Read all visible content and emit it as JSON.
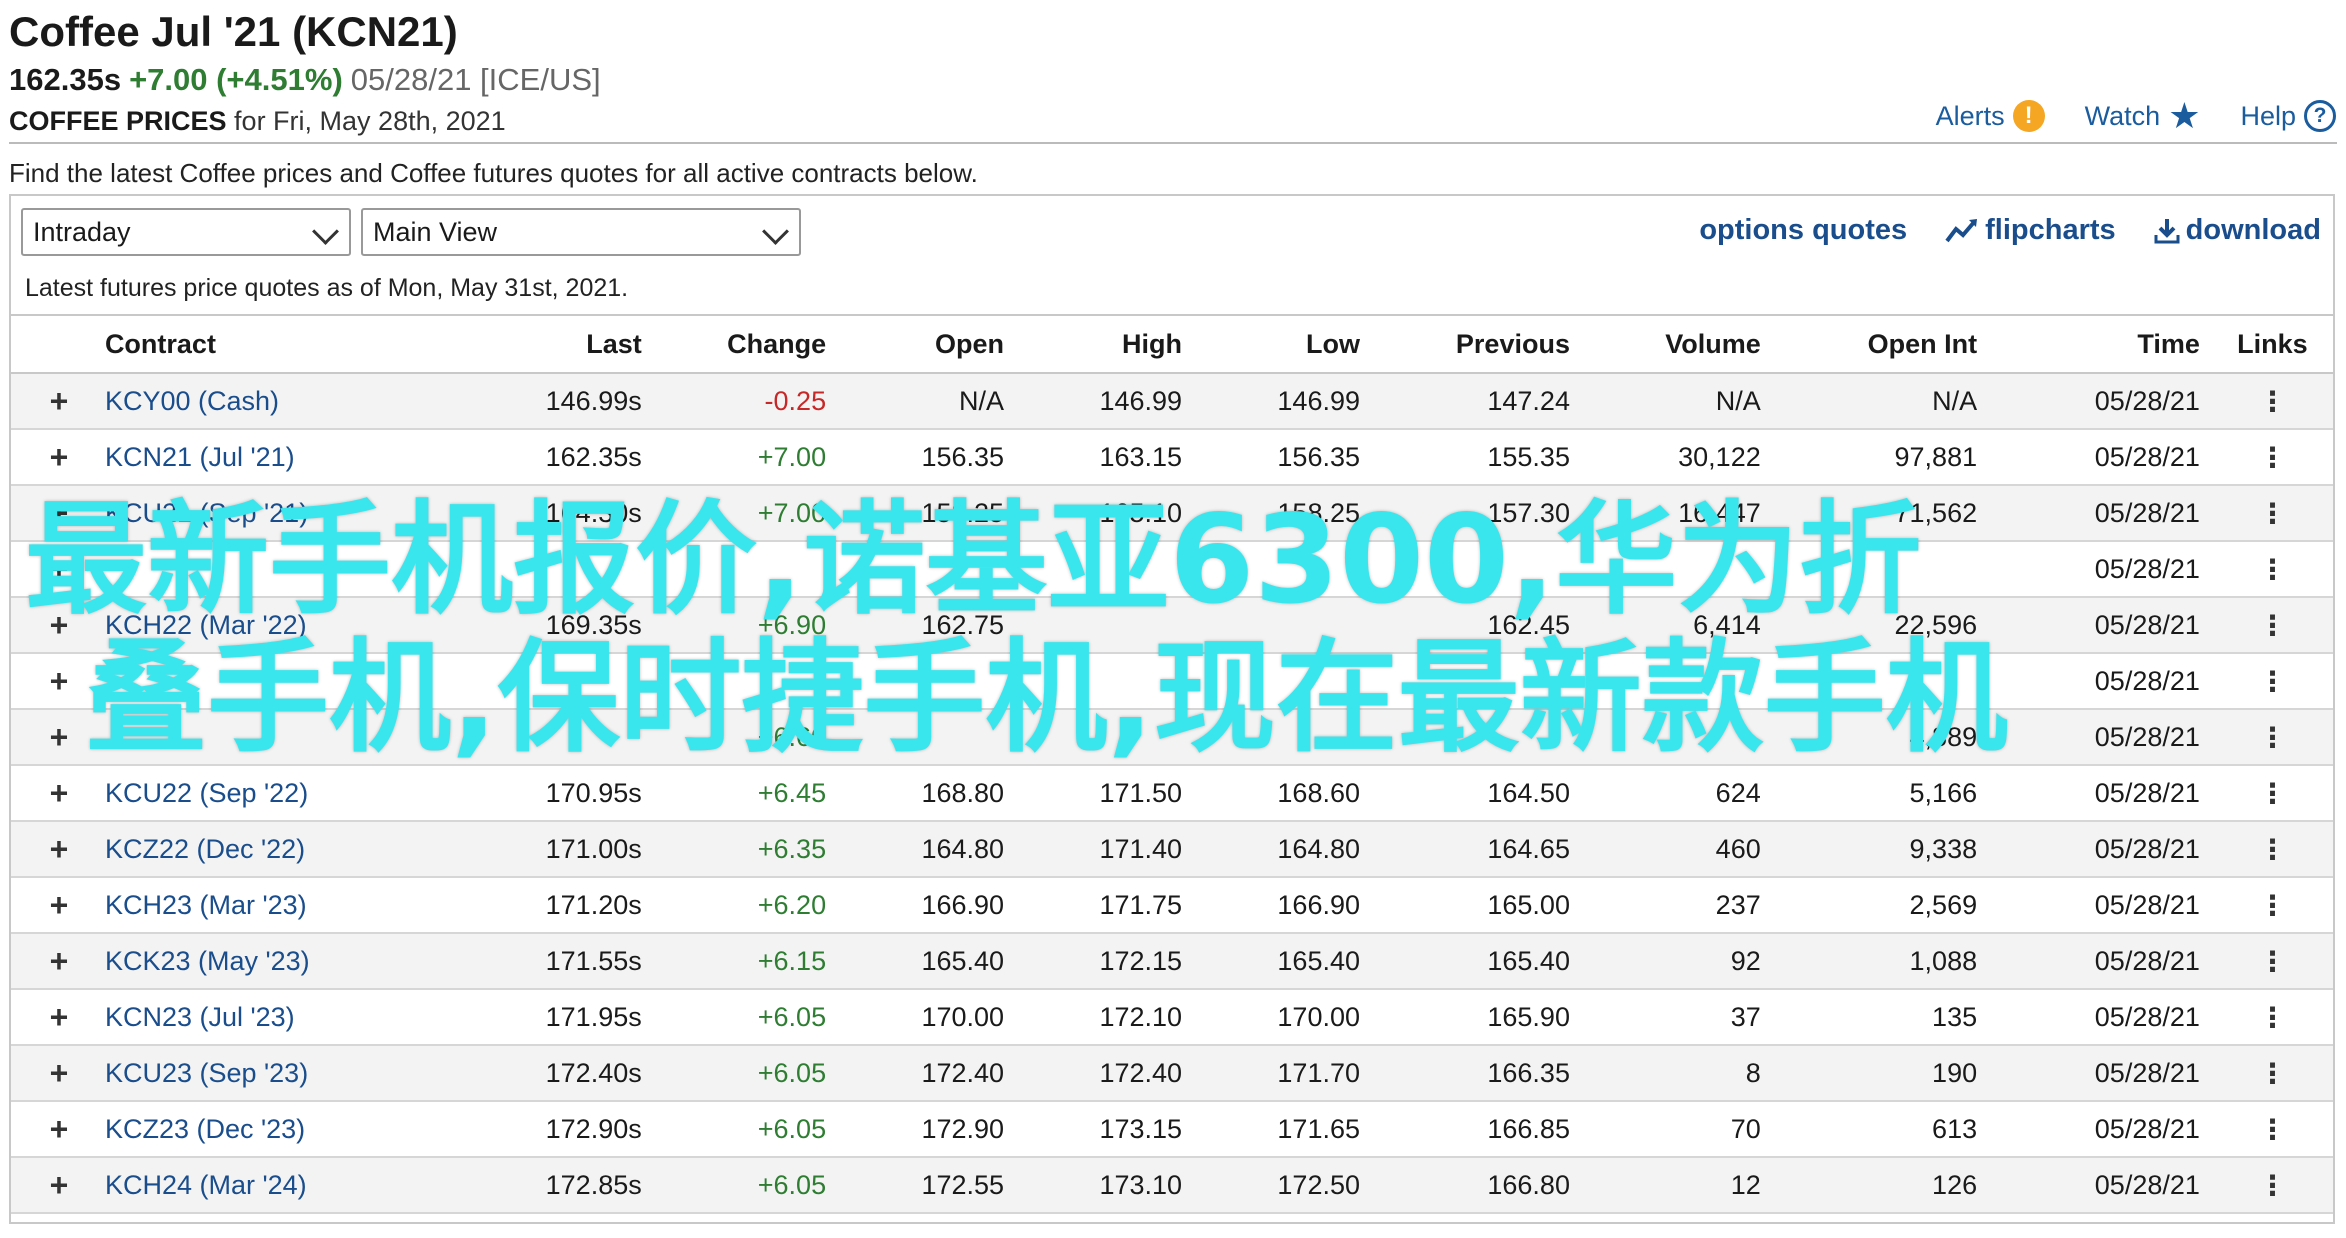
{
  "header": {
    "title": "Coffee Jul '21 (KCN21)",
    "price": "162.35s",
    "change": "+7.00 (+4.51%)",
    "meta": "05/28/21 [ICE/US]",
    "sub_bold": "COFFEE PRICES",
    "sub_rest": "for Fri, May 28th, 2021"
  },
  "toplinks": {
    "alerts": "Alerts",
    "watch": "Watch",
    "help": "Help"
  },
  "intro": "Find the latest Coffee prices and Coffee futures quotes for all active contracts below.",
  "controls": {
    "period_select": "Intraday",
    "view_select": "Main View",
    "options_quotes": "options quotes",
    "flipcharts": "flipcharts",
    "download": "download"
  },
  "as_of": "Latest futures price quotes as of Mon, May 31st, 2021.",
  "columns": [
    "Contract",
    "Last",
    "Change",
    "Open",
    "High",
    "Low",
    "Previous",
    "Volume",
    "Open Int",
    "Time",
    "Links"
  ],
  "rows": [
    {
      "contract": "KCY00 (Cash)",
      "last": "146.99s",
      "change": "-0.25",
      "open": "N/A",
      "high": "146.99",
      "low": "146.99",
      "previous": "147.24",
      "volume": "N/A",
      "open_int": "N/A",
      "time": "05/28/21"
    },
    {
      "contract": "KCN21 (Jul '21)",
      "last": "162.35s",
      "change": "+7.00",
      "open": "156.35",
      "high": "163.15",
      "low": "156.35",
      "previous": "155.35",
      "volume": "30,122",
      "open_int": "97,881",
      "time": "05/28/21"
    },
    {
      "contract": "KCU21 (Sep '21)",
      "last": "164.30s",
      "change": "+7.00",
      "open": "158.25",
      "high": "165.10",
      "low": "158.25",
      "previous": "157.30",
      "volume": "16,447",
      "open_int": "71,562",
      "time": "05/28/21"
    },
    {
      "contract": "",
      "last": "",
      "change": "",
      "open": "",
      "high": "",
      "low": "",
      "previous": "",
      "volume": "",
      "open_int": "",
      "time": "05/28/21"
    },
    {
      "contract": "KCH22 (Mar '22)",
      "last": "169.35s",
      "change": "+6.90",
      "open": "162.75",
      "high": "",
      "low": "",
      "previous": "162.45",
      "volume": "6,414",
      "open_int": "22,596",
      "time": "05/28/21"
    },
    {
      "contract": "",
      "last": "",
      "change": "",
      "open": "",
      "high": "",
      "low": "",
      "previous": "",
      "volume": "",
      "open_int": "",
      "time": "05/28/21"
    },
    {
      "contract": "",
      "last": "",
      "change": "+6.60",
      "open": "",
      "high": "",
      "low": "",
      "previous": "",
      "volume": "",
      "open_int": "4,889",
      "time": "05/28/21"
    },
    {
      "contract": "KCU22 (Sep '22)",
      "last": "170.95s",
      "change": "+6.45",
      "open": "168.80",
      "high": "171.50",
      "low": "168.60",
      "previous": "164.50",
      "volume": "624",
      "open_int": "5,166",
      "time": "05/28/21"
    },
    {
      "contract": "KCZ22 (Dec '22)",
      "last": "171.00s",
      "change": "+6.35",
      "open": "164.80",
      "high": "171.40",
      "low": "164.80",
      "previous": "164.65",
      "volume": "460",
      "open_int": "9,338",
      "time": "05/28/21"
    },
    {
      "contract": "KCH23 (Mar '23)",
      "last": "171.20s",
      "change": "+6.20",
      "open": "166.90",
      "high": "171.75",
      "low": "166.90",
      "previous": "165.00",
      "volume": "237",
      "open_int": "2,569",
      "time": "05/28/21"
    },
    {
      "contract": "KCK23 (May '23)",
      "last": "171.55s",
      "change": "+6.15",
      "open": "165.40",
      "high": "172.15",
      "low": "165.40",
      "previous": "165.40",
      "volume": "92",
      "open_int": "1,088",
      "time": "05/28/21"
    },
    {
      "contract": "KCN23 (Jul '23)",
      "last": "171.95s",
      "change": "+6.05",
      "open": "170.00",
      "high": "172.10",
      "low": "170.00",
      "previous": "165.90",
      "volume": "37",
      "open_int": "135",
      "time": "05/28/21"
    },
    {
      "contract": "KCU23 (Sep '23)",
      "last": "172.40s",
      "change": "+6.05",
      "open": "172.40",
      "high": "172.40",
      "low": "171.70",
      "previous": "166.35",
      "volume": "8",
      "open_int": "190",
      "time": "05/28/21"
    },
    {
      "contract": "KCZ23 (Dec '23)",
      "last": "172.90s",
      "change": "+6.05",
      "open": "172.90",
      "high": "173.15",
      "low": "171.65",
      "previous": "166.85",
      "volume": "70",
      "open_int": "613",
      "time": "05/28/21"
    },
    {
      "contract": "KCH24 (Mar '24)",
      "last": "172.85s",
      "change": "+6.05",
      "open": "172.55",
      "high": "173.10",
      "low": "172.50",
      "previous": "166.80",
      "volume": "12",
      "open_int": "126",
      "time": "05/28/21"
    }
  ],
  "overlay": {
    "line1": "最新手机报价,诺基亚6300,华为折",
    "line2": "叠手机,保时捷手机,现在最新款手机",
    "color": "#39e6ee"
  },
  "colors": {
    "link": "#1a4d8c",
    "positive": "#2e7d32",
    "negative": "#c62828",
    "alert": "#f5a623"
  }
}
